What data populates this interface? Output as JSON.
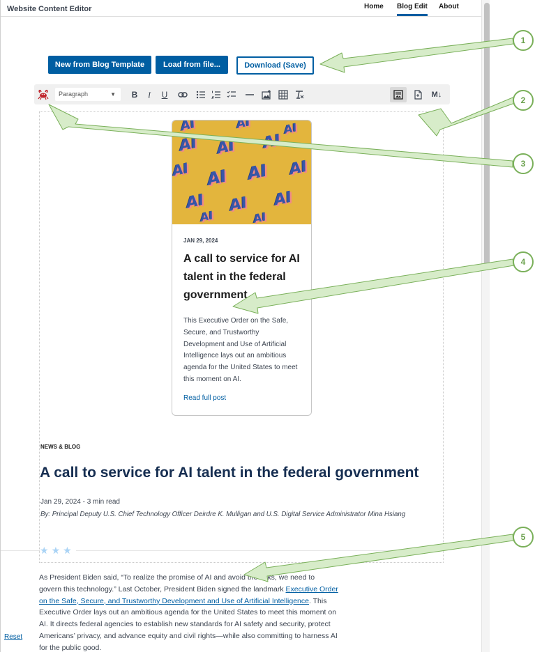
{
  "app": {
    "title": "Website Content Editor"
  },
  "nav": {
    "home": "Home",
    "blog_edit": "Blog Edit",
    "about": "About"
  },
  "actions": {
    "new_template": "New from Blog Template",
    "load_file": "Load from file...",
    "download": "Download (Save)"
  },
  "toolbar": {
    "block_type": "Paragraph",
    "icons": [
      "crab-logo-icon",
      "bold-icon",
      "italic-icon",
      "underline-icon",
      "link-icon",
      "bullet-list-icon",
      "numbered-list-icon",
      "checklist-icon",
      "horizontal-rule-icon",
      "image-icon",
      "table-icon",
      "clear-formatting-icon",
      "rich-text-view-icon",
      "source-view-icon",
      "markdown-icon"
    ],
    "bold": "B",
    "italic": "I",
    "underline": "U",
    "markdown": "M↓"
  },
  "card": {
    "image_text": "AI",
    "date": "JAN 29, 2024",
    "title": "A call to service for AI talent in the federal government",
    "summary": "This Executive Order on the Safe, Secure, and Trustworthy Development and Use of Artificial Intelligence lays out an ambitious agenda for the United States to meet this moment on AI.",
    "link": "Read full post"
  },
  "article": {
    "kicker": "NEWS & BLOG",
    "headline": "A call to service for AI talent in the federal government",
    "meta": "Jan 29, 2024 - 3 min read",
    "byline": "By: Principal Deputy U.S. Chief Technology Officer Deirdre K. Mulligan and U.S. Digital Service Administrator Mina Hsiang",
    "stars": "★",
    "body_1": "As President Biden said, “To realize the promise of AI and avoid the risks, we need to govern this technology.” Last October, President Biden signed the landmark ",
    "body_link": "Executive Order on the Safe, Secure, and Trustworthy Development and Use of Artificial Intelligence",
    "body_2": ". This Executive Order lays out an ambitious agenda for the United States to meet this moment on AI. It directs federal agencies to establish new standards for AI safety and security, protect Americans’ privacy, and advance equity and civil rights—while also committing to harness AI for the public good."
  },
  "footer": {
    "reset": "Reset"
  },
  "callouts": [
    "1",
    "2",
    "3",
    "4",
    "5"
  ],
  "colors": {
    "primary": "#005ea2",
    "headline": "#162e51",
    "callout": "#7ab05a",
    "arrow_fill": "#d7ecc9",
    "image_bg": "#e3b53d"
  }
}
